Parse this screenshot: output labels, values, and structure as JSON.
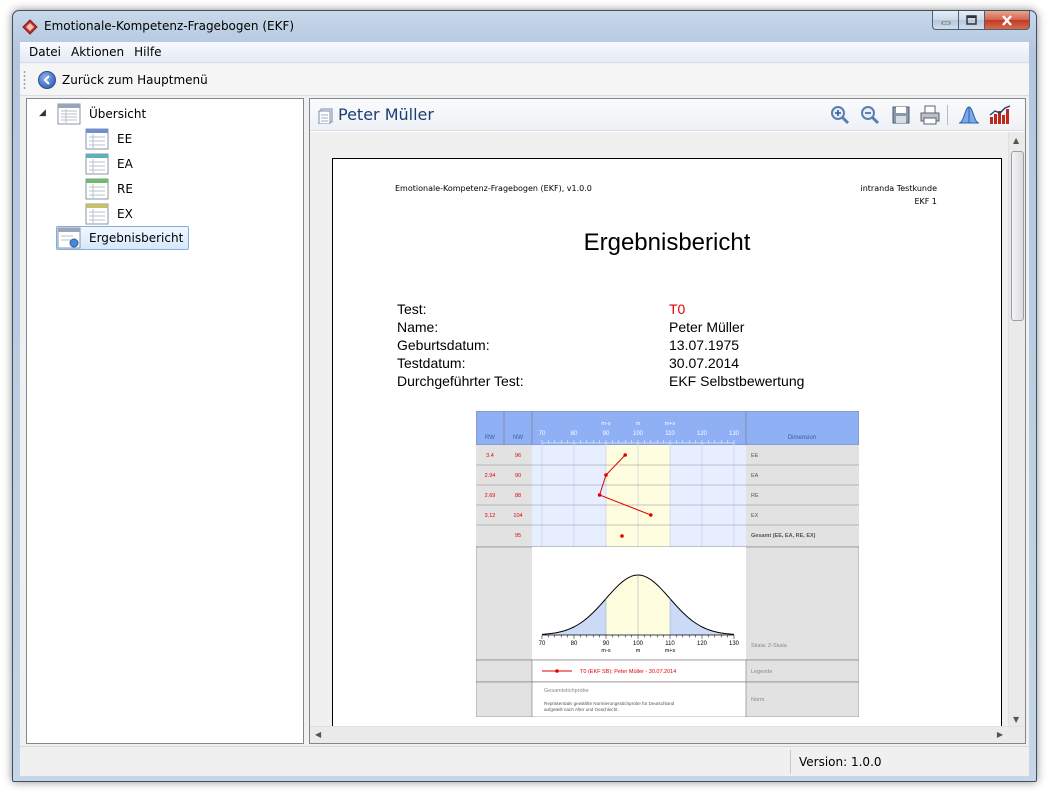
{
  "window": {
    "title": "Emotionale-Kompetenz-Fragebogen (EKF)"
  },
  "menu": [
    "Datei",
    "Aktionen",
    "Hilfe"
  ],
  "toolbar": {
    "back_label": "Zurück zum Hauptmenü"
  },
  "tree": {
    "root": "Übersicht",
    "children": [
      "EE",
      "EA",
      "RE",
      "EX"
    ],
    "selected": "Ergebnisbericht"
  },
  "report": {
    "header_title": "Peter Müller",
    "doc_header_left": "Emotionale-Kompetenz-Fragebogen (EKF), v1.0.0",
    "doc_header_right_1": "intranda Testkunde",
    "doc_header_right_2": "EKF 1",
    "heading": "Ergebnisbericht",
    "info": [
      {
        "label": "Test:",
        "value": "T0",
        "highlight": true
      },
      {
        "label": "Name:",
        "value": "Peter Müller",
        "highlight": false
      },
      {
        "label": "Geburtsdatum:",
        "value": "13.07.1975",
        "highlight": false
      },
      {
        "label": "Testdatum:",
        "value": "30.07.2014",
        "highlight": false
      },
      {
        "label": "Durchgeführter Test:",
        "value": "EKF Selbstbewertung",
        "highlight": false
      }
    ]
  },
  "chart_data": {
    "type": "line",
    "columns": {
      "rw": "RW",
      "nw": "NW",
      "dimension": "Dimension"
    },
    "scale_ticks": [
      "70",
      "80",
      "90",
      "100",
      "110",
      "120",
      "130"
    ],
    "scale_markers": {
      "m_minus_s": "m-s",
      "m": "m",
      "m_plus_s": "m+s"
    },
    "xlim": [
      70,
      130
    ],
    "rows": [
      {
        "rw": "3.4",
        "nw": 96,
        "dimension": "EE"
      },
      {
        "rw": "2.94",
        "nw": 90,
        "dimension": "EA"
      },
      {
        "rw": "2.69",
        "nw": 88,
        "dimension": "RE"
      },
      {
        "rw": "3.12",
        "nw": 104,
        "dimension": "EX"
      }
    ],
    "total": {
      "rw": "",
      "nw": 95,
      "dimension": "Gesamt (EE, EA, RE, EX)"
    },
    "scale_label": "Skala: Z-Skala",
    "legend_label": "Legende",
    "legend_entry": "T0 (EKF SB): Peter Müller - 30.07.2014",
    "norm_label": "Norm",
    "norm_title": "Gesamtstichprobe",
    "norm_text_1": "Repräsentativ gewählte Normierungsstichprobe für Deutschland",
    "norm_text_2": "aufgeteilt nach Alter und Geschlecht."
  },
  "status": {
    "version": "Version: 1.0.0"
  },
  "colors": {
    "accent": "#1b3f73",
    "series": "#e10000",
    "header_blue": "#8fb0f5",
    "band_yellow": "#fffde0"
  }
}
